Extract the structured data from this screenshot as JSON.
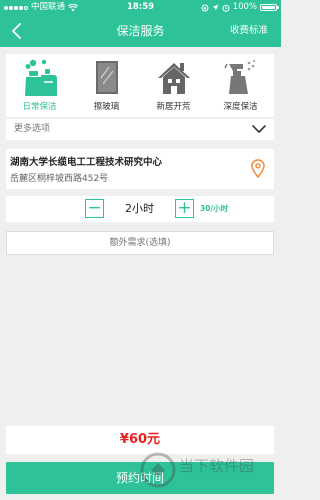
{
  "status_bar": {
    "carrier": "中国联通",
    "time": "18:59",
    "battery": "100%"
  },
  "header": {
    "title": "保洁服务",
    "fee_link": "收费标准"
  },
  "services": [
    {
      "label": "日常保洁",
      "icon": "cleaning-supplies-icon",
      "active": true
    },
    {
      "label": "擦玻璃",
      "icon": "glass-window-icon",
      "active": false
    },
    {
      "label": "新居开荒",
      "icon": "house-icon",
      "active": false
    },
    {
      "label": "深度保洁",
      "icon": "spray-bottle-icon",
      "active": false
    }
  ],
  "more_options": {
    "label": "更多选项"
  },
  "address": {
    "name": "湖南大学长缆电工工程技术研究中心",
    "street": "岳麓区桐梓坡西路452号"
  },
  "hours": {
    "minus": "−",
    "plus": "+",
    "value": "2小时",
    "price": "30/小时"
  },
  "extra": {
    "label": "额外需求(选填)"
  },
  "total": {
    "amount": "¥60元"
  },
  "book_button": {
    "label": "预约时间"
  },
  "watermark": {
    "text": "当下软件园"
  },
  "colors": {
    "accent": "#2ec298",
    "price_red": "#e8211f",
    "location_orange": "#f08a3c"
  }
}
